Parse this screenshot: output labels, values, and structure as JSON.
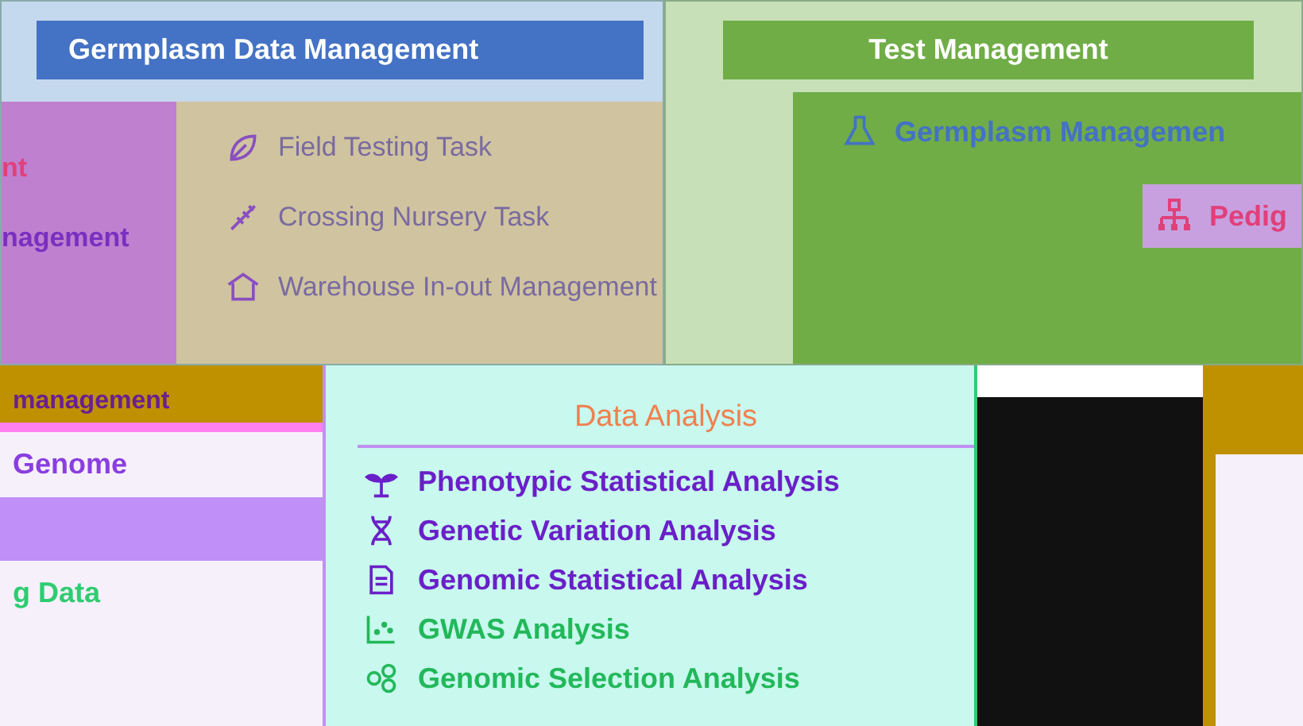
{
  "germplasm_panel": {
    "title": "Germplasm Data Management",
    "side_items": [
      {
        "label": "nt",
        "color": "#e0407a"
      },
      {
        "label": "nagement",
        "color": "#7a2fc0"
      }
    ],
    "items": [
      {
        "label": "Field Testing Task"
      },
      {
        "label": "Crossing Nursery Task"
      },
      {
        "label": "Warehouse In-out Management"
      }
    ]
  },
  "test_panel": {
    "title": "Test Management",
    "items": [
      {
        "label": "Germplasm Managemen",
        "color": "#4472c4"
      },
      {
        "label": "Pedig",
        "color": "#e0407a"
      }
    ]
  },
  "genome_panel": {
    "title": "management",
    "items": [
      {
        "label": "Genome",
        "color": "#8a3ee0"
      },
      {
        "label": "g Data",
        "color": "#2ecc71"
      }
    ]
  },
  "analysis_panel": {
    "title": "Data Analysis",
    "items": [
      {
        "label": "Phenotypic Statistical Analysis",
        "color": "#6a1fc8"
      },
      {
        "label": "Genetic Variation Analysis",
        "color": "#6a1fc8"
      },
      {
        "label": "Genomic Statistical Analysis",
        "color": "#6a1fc8"
      },
      {
        "label": "GWAS Analysis",
        "color": "#22b85a"
      },
      {
        "label": "Genomic Selection Analysis",
        "color": "#22b85a"
      }
    ]
  }
}
